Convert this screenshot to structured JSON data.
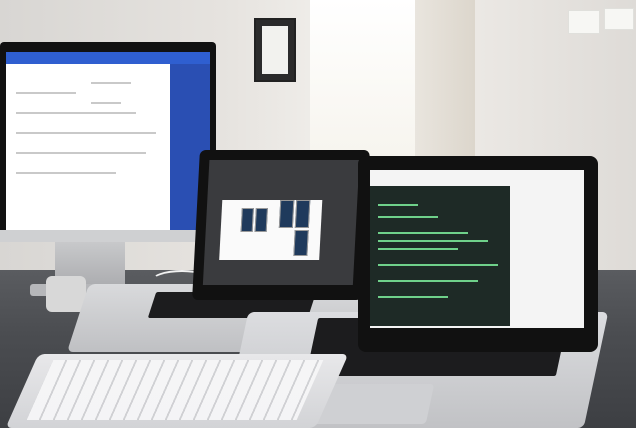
{
  "image": {
    "colors": {
      "wall": "#e6e3df",
      "desk": "#4b4d51",
      "monitor_bezel": "#111111",
      "doc_accent": "#2f5fd0",
      "terminal_bg": "#1e2a26",
      "terminal_text": "#6fd08a",
      "aluminum": "#d9dadc"
    }
  }
}
